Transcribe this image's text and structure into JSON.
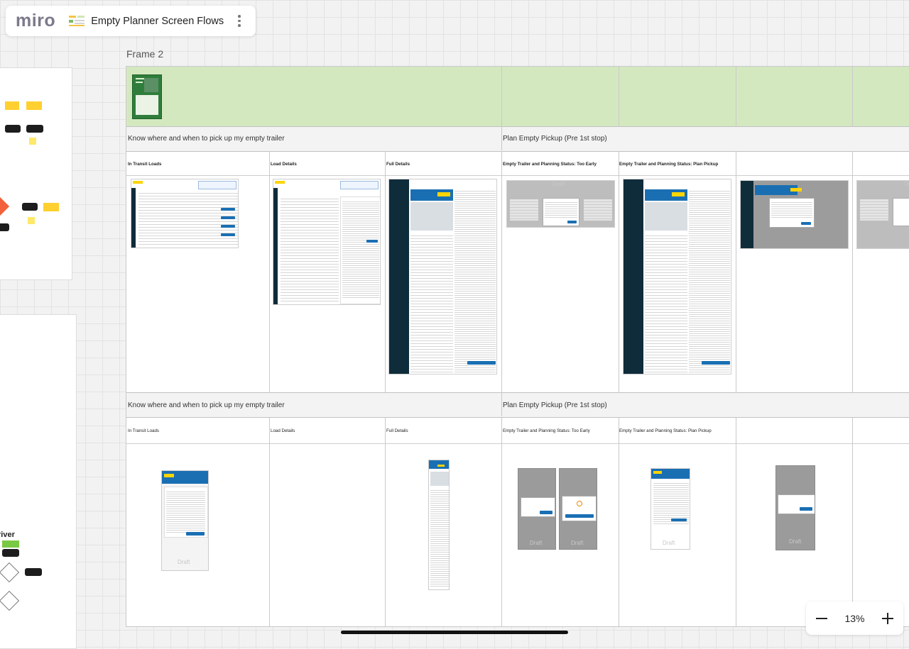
{
  "app": {
    "logo_text": "miro",
    "board_title": "Empty Planner Screen Flows"
  },
  "frame": {
    "label": "Frame 2",
    "groups": [
      "Know where and when to pick up my empty trailer",
      "Plan Empty Pickup (Pre 1st stop)"
    ],
    "columns_row1": [
      "In Transit Loads",
      "Load Details",
      "Full Details",
      "Empty Trailer and Planning Status: Too Early",
      "Empty Trailer and Planning Status: Plan Pickup"
    ],
    "columns_row2": [
      "In Transit Loads",
      "Load Details",
      "Full Details",
      "Empty Trailer and Planning Status: Too Early",
      "Empty Trailer and Planning Status: Plan Pickup"
    ]
  },
  "side": {
    "partial_label": "river"
  },
  "zoom": {
    "value": "13%"
  },
  "colors": {
    "frame_band": "#d4e8c0",
    "nav_dark": "#0f2c3b",
    "accent_blue": "#1a6fb3",
    "yellow": "#ffd400"
  },
  "icons": {
    "menu": "kebab-icon",
    "zoom_out": "minus-icon",
    "zoom_in": "plus-icon"
  }
}
